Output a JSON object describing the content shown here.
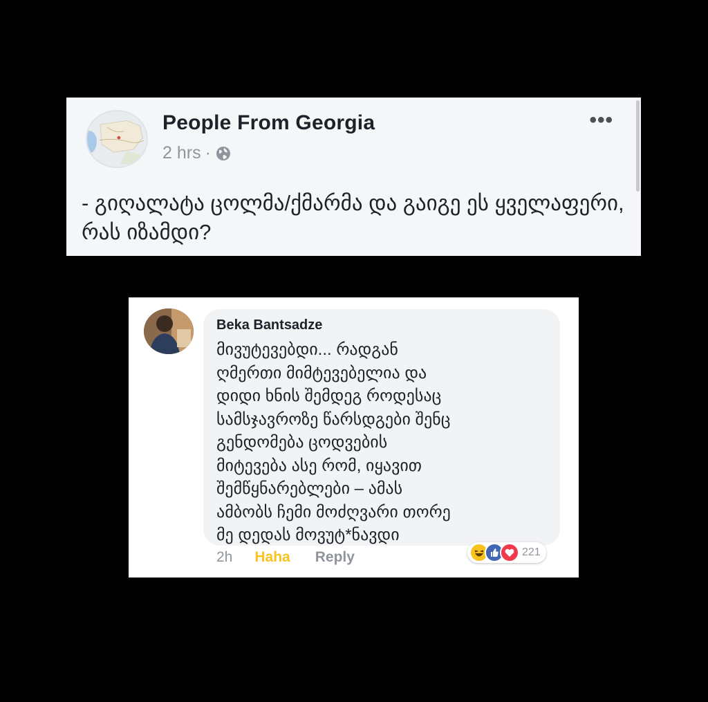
{
  "post": {
    "page_name": "People From Georgia",
    "time": "2 hrs",
    "separator": "·",
    "privacy_icon": "globe-icon",
    "more_label": "•••",
    "text": "- გიღალატა ცოლმა/ქმარმა და გაიგე ეს ყველაფერი, რას იზამდი?"
  },
  "comment": {
    "author": "Beka Bantsadze",
    "text_lines": [
      "მივუტევებდი... რადგან",
      "ღმერთი მიმტევებელია და",
      "დიდი ხნის შემდეგ როდესაც",
      "სამსჯავროზე წარსდგები შენც",
      "გენდომება ცოდვების",
      "მიტევება ასე რომ, იყავით",
      "შემწყნარებლები – ამას",
      "ამბობს ჩემი მოძღვარი თორე",
      "მე დედას მოვუტ*ნავდი"
    ],
    "time": "2h",
    "haha_label": "Haha",
    "reply_label": "Reply",
    "reaction_icons": [
      "haha-reaction-icon",
      "like-reaction-icon",
      "love-reaction-icon"
    ],
    "reaction_count": "221"
  },
  "colors": {
    "background": "#000000",
    "post_card": "#f5f6f7",
    "comment_bubble": "#f2f3f5",
    "haha": "#f7c31c",
    "like": "#4267b2",
    "love": "#f0394c"
  }
}
